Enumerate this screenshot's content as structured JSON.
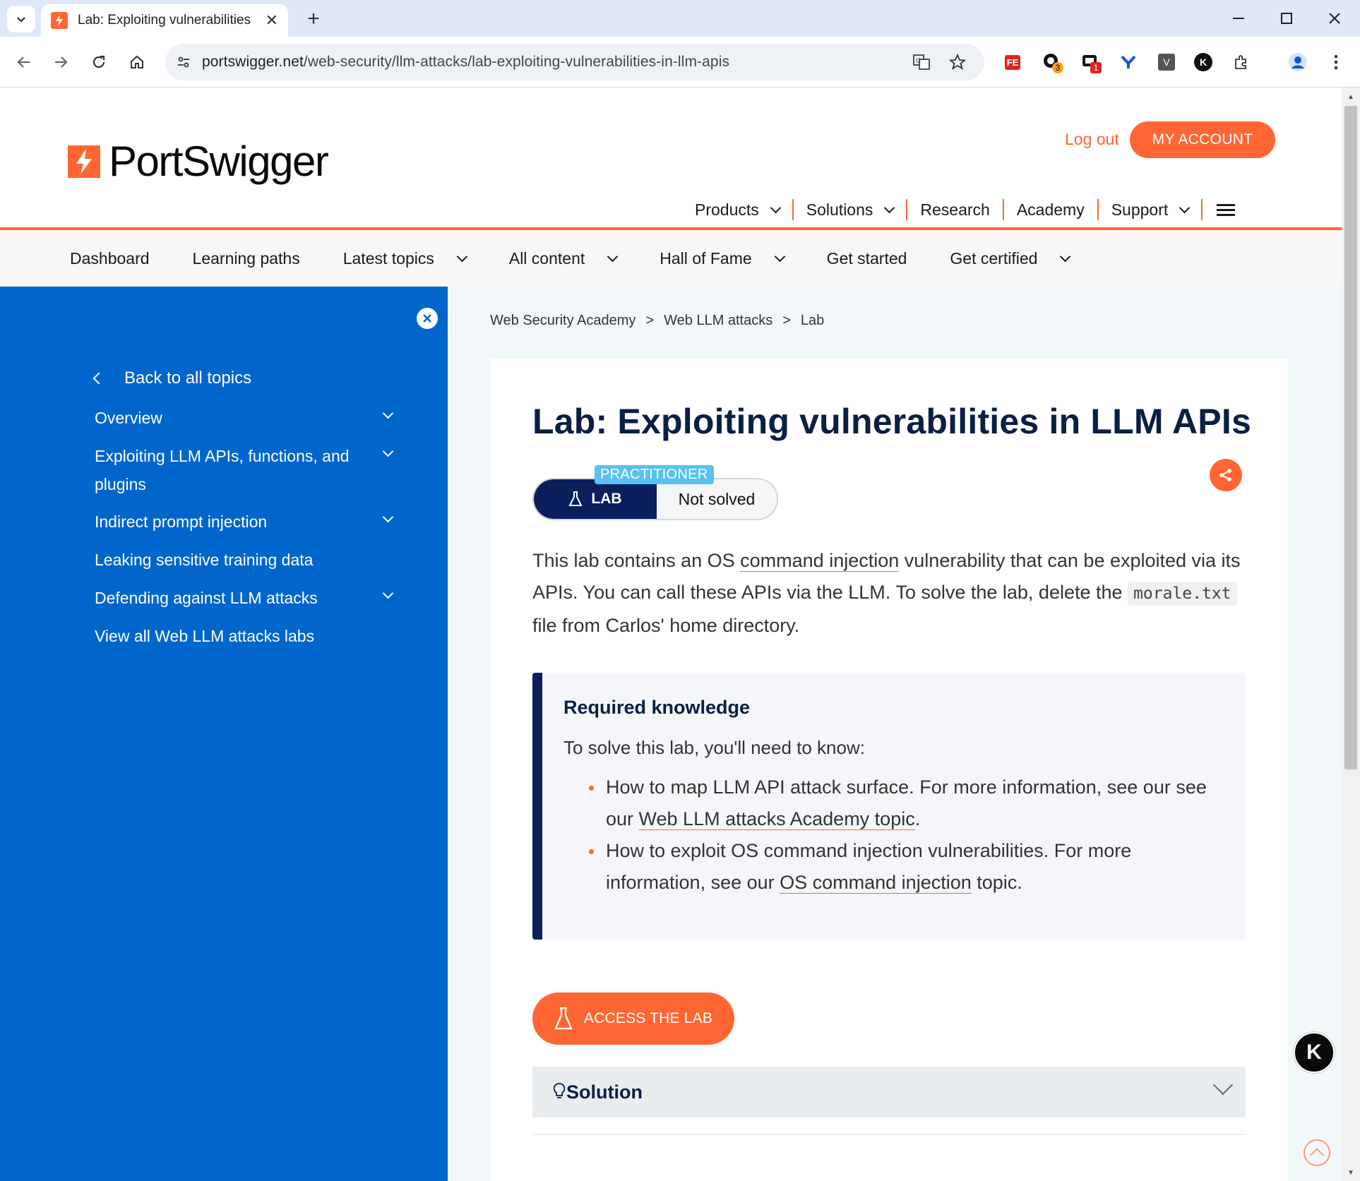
{
  "browser": {
    "tab_title": "Lab: Exploiting vulnerabilities",
    "tab_close": "✕",
    "new_tab": "+",
    "url_host": "portswigger.net",
    "url_path": "/web-security/llm-attacks/lab-exploiting-vulnerabilities-in-llm-apis",
    "ext_badges": {
      "ext2": "3",
      "ext3": "1"
    },
    "ext_labels": {
      "fe": "FE",
      "v": "V",
      "k": "K"
    }
  },
  "header": {
    "logo_text": "PortSwigger",
    "logout": "Log out",
    "my_account": "MY ACCOUNT",
    "nav": [
      "Products",
      "Solutions",
      "Research",
      "Academy",
      "Support"
    ]
  },
  "subnav": [
    "Dashboard",
    "Learning paths",
    "Latest topics",
    "All content",
    "Hall of Fame",
    "Get started",
    "Get certified"
  ],
  "sidebar": {
    "back": "Back to all topics",
    "items": [
      "Overview",
      "Exploiting LLM APIs, functions, and plugins",
      "Indirect prompt injection",
      "Leaking sensitive training data",
      "Defending against LLM attacks",
      "View all Web LLM attacks labs"
    ]
  },
  "breadcrumb": [
    "Web Security Academy",
    ">",
    "Web LLM attacks",
    ">",
    "Lab"
  ],
  "lab": {
    "title": "Lab: Exploiting vulnerabilities in LLM APIs",
    "level": "PRACTITIONER",
    "badge": "LAB",
    "status": "Not solved",
    "intro_1": "This lab contains an OS ",
    "intro_link": "command injection",
    "intro_2": " vulnerability that can be exploited via its APIs. You can call these APIs via the LLM. To solve the lab, delete the ",
    "intro_code": "morale.txt",
    "intro_3": " file from Carlos' home directory."
  },
  "knowledge": {
    "heading": "Required knowledge",
    "lead": "To solve this lab, you'll need to know:",
    "item1_text": "How to map LLM API attack surface. For more information, see our see our ",
    "item1_link": "Web LLM attacks Academy topic",
    "item1_end": ".",
    "item2_text": "How to exploit OS command injection vulnerabilities. For more information, see our ",
    "item2_link": "OS command injection",
    "item2_end": " topic."
  },
  "access_button": "ACCESS THE LAB",
  "solution_label": "Solution",
  "floating_badge": "K",
  "colors": {
    "accent": "#ff6633",
    "sidebar": "#0066cc",
    "navy": "#0a1f5c",
    "practitioner": "#57c1f2"
  }
}
